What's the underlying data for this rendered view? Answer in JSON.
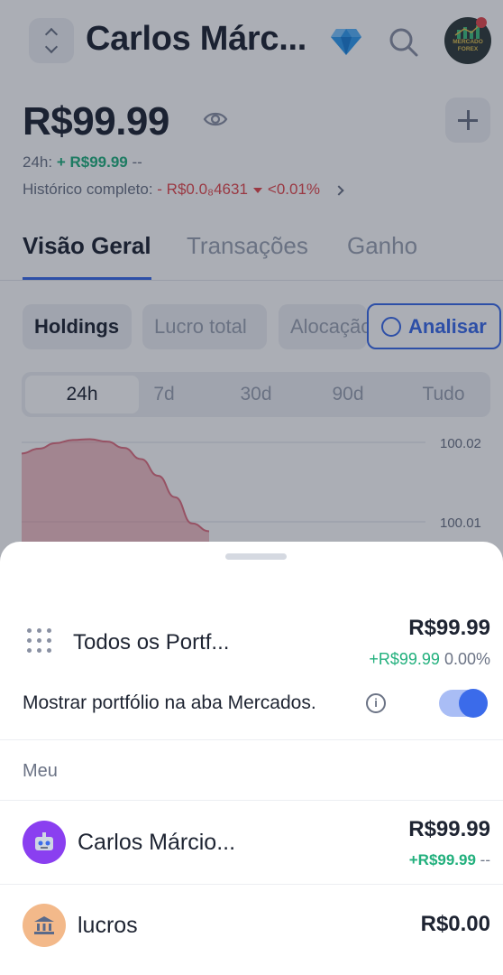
{
  "header": {
    "portfolio_title": "Carlos Márc...",
    "avatar_text": "MERCADO FOREX"
  },
  "summary": {
    "balance": "R$99.99",
    "change_24h_label": "24h:",
    "change_24h_value": "+ R$99.99",
    "change_24h_pct": "--",
    "history_label": "Histórico completo:",
    "history_value": "- R$0.0₈4631",
    "history_pct": "<0.01%"
  },
  "tabs": [
    {
      "label": "Visão Geral",
      "active": true
    },
    {
      "label": "Transações",
      "active": false
    },
    {
      "label": "Ganho",
      "active": false
    }
  ],
  "chips": [
    {
      "label": "Holdings",
      "active": true
    },
    {
      "label": "Lucro total",
      "active": false
    },
    {
      "label": "Alocação",
      "active": false
    }
  ],
  "analyze_label": "Analisar",
  "periods": [
    {
      "label": "24h",
      "active": true
    },
    {
      "label": "7d",
      "active": false
    },
    {
      "label": "30d",
      "active": false
    },
    {
      "label": "90d",
      "active": false
    },
    {
      "label": "Tudo",
      "active": false
    }
  ],
  "chart_data": {
    "type": "area",
    "y_ticks": [
      "100.02",
      "100.01"
    ],
    "series": [
      {
        "values": [
          100.0186,
          100.0192,
          100.0199,
          100.0203,
          100.0204,
          100.0201,
          100.0193,
          100.0179,
          100.0158,
          100.0131,
          100.0098,
          100.0088
        ]
      }
    ],
    "color": "#e07080"
  },
  "sheet": {
    "all_portfolios": {
      "name": "Todos os Portf...",
      "value": "R$99.99",
      "change_value": "+R$99.99",
      "change_pct": "0.00%"
    },
    "toggle_label": "Mostrar portfólio na aba Mercados.",
    "toggle_on": true,
    "section_label": "Meu",
    "portfolios": [
      {
        "name": "Carlos Márcio...",
        "value": "R$99.99",
        "change_value": "+R$99.99",
        "change_pct": "--",
        "icon": "robot-icon",
        "color": "#8a3ff0"
      },
      {
        "name": "lucros",
        "value": "R$0.00",
        "icon": "bank-icon",
        "color": "#f3b98a"
      }
    ]
  },
  "colors": {
    "accent": "#3b6bea",
    "positive": "#22b07d",
    "negative": "#e5484d"
  }
}
